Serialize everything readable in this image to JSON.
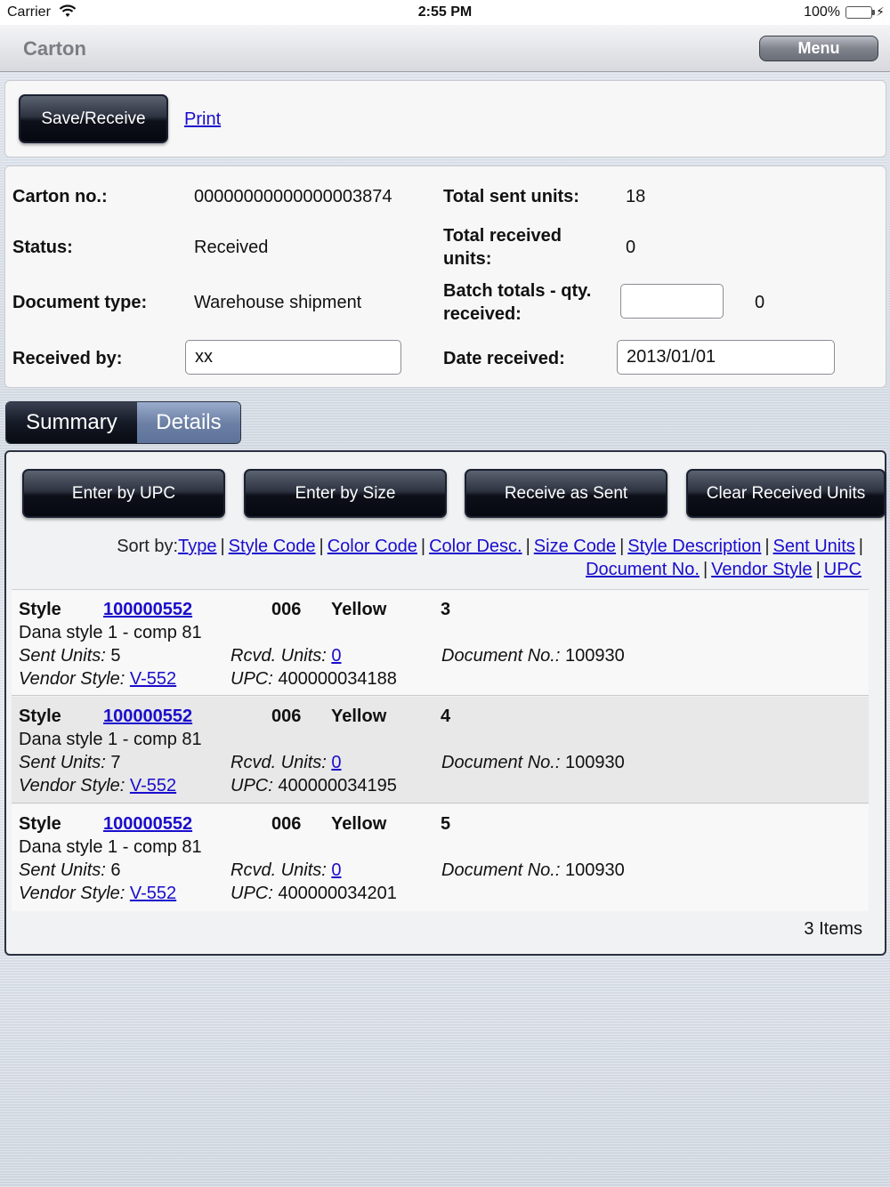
{
  "status_bar": {
    "carrier": "Carrier",
    "time": "2:55 PM",
    "battery": "100%"
  },
  "nav": {
    "title": "Carton",
    "menu_label": "Menu"
  },
  "actions": {
    "save_label": "Save/Receive",
    "print_label": "Print"
  },
  "details": {
    "carton_no_label": "Carton no.:",
    "carton_no_value": "00000000000000003874",
    "status_label": "Status:",
    "status_value": "Received",
    "doc_type_label": "Document type:",
    "doc_type_value": "Warehouse shipment",
    "received_by_label": "Received by:",
    "received_by_value": "xx",
    "total_sent_label": "Total sent units:",
    "total_sent_value": "18",
    "total_received_label": "Total received units:",
    "total_received_value": "0",
    "batch_totals_label": "Batch totals - qty. received:",
    "batch_totals_input": "",
    "batch_totals_value": "0",
    "date_received_label": "Date received:",
    "date_received_value": "2013/01/01"
  },
  "tabs": {
    "summary": "Summary",
    "details": "Details",
    "active": "details"
  },
  "toolbar": {
    "enter_upc": "Enter by UPC",
    "enter_size": "Enter by Size",
    "receive_sent": "Receive as Sent",
    "clear_received": "Clear Received Units"
  },
  "sort": {
    "prefix": "Sort by:",
    "links": [
      "Type",
      "Style Code",
      "Color Code",
      "Color Desc.",
      "Size Code",
      "Style Description",
      "Sent Units",
      "Document No.",
      "Vendor Style",
      "UPC"
    ]
  },
  "items": [
    {
      "type": "Style",
      "style_code": "100000552",
      "color_code": "006",
      "color_desc": "Yellow",
      "size": "3",
      "description": "Dana style 1 - comp 81",
      "sent_label": "Sent Units:",
      "sent": "5",
      "rcvd_label": "Rcvd. Units:",
      "rcvd": "0",
      "doc_label": "Document No.:",
      "doc": "100930",
      "vendor_label": "Vendor Style:",
      "vendor": "V-552",
      "upc_label": "UPC:",
      "upc": "400000034188"
    },
    {
      "type": "Style",
      "style_code": "100000552",
      "color_code": "006",
      "color_desc": "Yellow",
      "size": "4",
      "description": "Dana style 1 - comp 81",
      "sent_label": "Sent Units:",
      "sent": "7",
      "rcvd_label": "Rcvd. Units:",
      "rcvd": "0",
      "doc_label": "Document No.:",
      "doc": "100930",
      "vendor_label": "Vendor Style:",
      "vendor": "V-552",
      "upc_label": "UPC:",
      "upc": "400000034195"
    },
    {
      "type": "Style",
      "style_code": "100000552",
      "color_code": "006",
      "color_desc": "Yellow",
      "size": "5",
      "description": "Dana style 1 - comp 81",
      "sent_label": "Sent Units:",
      "sent": "6",
      "rcvd_label": "Rcvd. Units:",
      "rcvd": "0",
      "doc_label": "Document No.:",
      "doc": "100930",
      "vendor_label": "Vendor Style:",
      "vendor": "V-552",
      "upc_label": "UPC:",
      "upc": "400000034201"
    }
  ],
  "item_count": "3 Items",
  "colors": {
    "link": "#1a0dcc",
    "button_dark": "#0d1019",
    "tab_active": "#6d81a6",
    "battery": "#2bc52b"
  }
}
